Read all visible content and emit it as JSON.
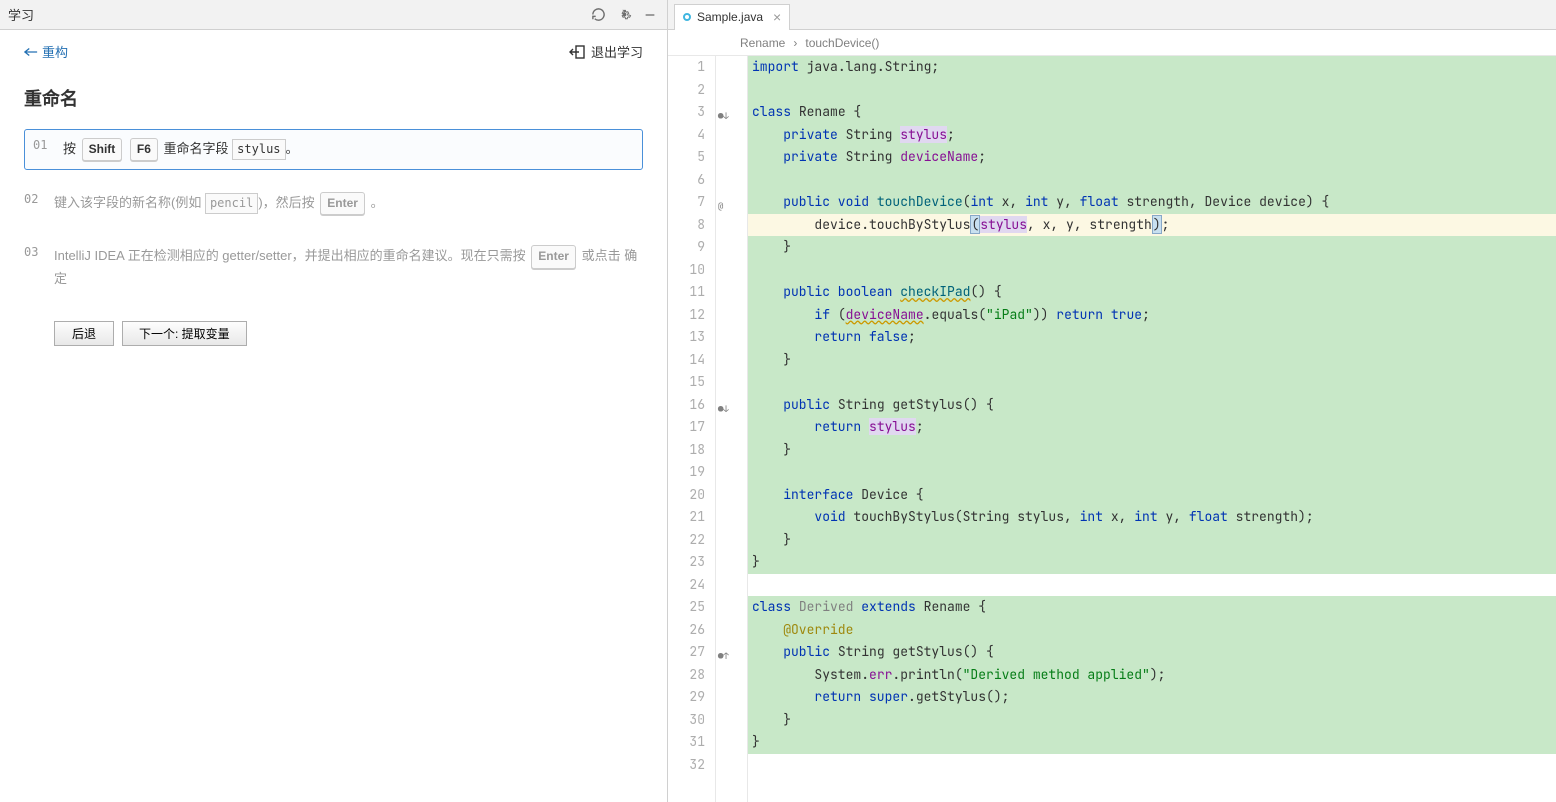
{
  "left": {
    "header_title": "学习",
    "back_label": "重构",
    "exit_label": "退出学习",
    "title": "重命名",
    "steps": [
      {
        "num": "01",
        "pre": "按 ",
        "k1": "Shift",
        "k2": "F6",
        "mid": " 重命名字段 ",
        "code": "stylus",
        "post": "。"
      },
      {
        "num": "02",
        "pre": "键入该字段的新名称(例如 ",
        "code": "pencil",
        "mid": ")，然后按 ",
        "k1": "Enter",
        "post": " 。"
      },
      {
        "num": "03",
        "text_a": "IntelliJ IDEA 正在检测相应的 getter/setter，并提出相应的重命名建议。现在只需按 ",
        "k1": "Enter",
        "text_b": " 或点击 确定"
      }
    ],
    "btn_back": "后退",
    "btn_next": "下一个: 提取变量"
  },
  "tab": {
    "filename": "Sample.java"
  },
  "breadcrumb": {
    "a": "Rename",
    "b": "touchDevice()"
  },
  "code": {
    "lines": [
      {
        "n": 1,
        "hl": "g",
        "tokens": [
          [
            "kw",
            "import"
          ],
          [
            "",
            " java.lang.String;"
          ]
        ]
      },
      {
        "n": 2,
        "hl": "g",
        "tokens": [
          [
            "",
            ""
          ]
        ]
      },
      {
        "n": 3,
        "hl": "g",
        "mark": "●↓",
        "tokens": [
          [
            "kw",
            "class"
          ],
          [
            "",
            " Rename {"
          ]
        ]
      },
      {
        "n": 4,
        "hl": "g",
        "tokens": [
          [
            "",
            "    "
          ],
          [
            "kw",
            "private"
          ],
          [
            "",
            " String "
          ],
          [
            "field hl-mark",
            "stylus"
          ],
          [
            "",
            ";"
          ]
        ]
      },
      {
        "n": 5,
        "hl": "g",
        "tokens": [
          [
            "",
            "    "
          ],
          [
            "kw",
            "private"
          ],
          [
            "",
            " String "
          ],
          [
            "field",
            "deviceName"
          ],
          [
            "",
            ";"
          ]
        ]
      },
      {
        "n": 6,
        "hl": "g",
        "tokens": [
          [
            "",
            ""
          ]
        ]
      },
      {
        "n": 7,
        "hl": "g",
        "mark": "@",
        "tokens": [
          [
            "",
            "    "
          ],
          [
            "kw",
            "public void"
          ],
          [
            "",
            " "
          ],
          [
            "method-decl",
            "touchDevice"
          ],
          [
            "",
            "("
          ],
          [
            "kw",
            "int"
          ],
          [
            "",
            " x, "
          ],
          [
            "kw",
            "int"
          ],
          [
            "",
            " y, "
          ],
          [
            "kw",
            "float"
          ],
          [
            "",
            " strength, Device device) {"
          ]
        ]
      },
      {
        "n": 8,
        "hl": "y",
        "tokens": [
          [
            "",
            "        device.touchByStylus"
          ],
          [
            "hl-paren",
            "("
          ],
          [
            "field hl-mark",
            "stylus"
          ],
          [
            "",
            ", x, y, strength"
          ],
          [
            "hl-paren",
            ")"
          ],
          [
            "",
            ";"
          ]
        ]
      },
      {
        "n": 9,
        "hl": "g",
        "tokens": [
          [
            "",
            "    }"
          ]
        ]
      },
      {
        "n": 10,
        "hl": "g",
        "tokens": [
          [
            "",
            ""
          ]
        ]
      },
      {
        "n": 11,
        "hl": "g",
        "tokens": [
          [
            "",
            "    "
          ],
          [
            "kw",
            "public boolean"
          ],
          [
            "",
            " "
          ],
          [
            "method-decl warn",
            "checkIPad"
          ],
          [
            "",
            "() {"
          ]
        ]
      },
      {
        "n": 12,
        "hl": "g",
        "tokens": [
          [
            "",
            "        "
          ],
          [
            "kw",
            "if"
          ],
          [
            "",
            " ("
          ],
          [
            "field warn",
            "deviceName"
          ],
          [
            "",
            ".equals("
          ],
          [
            "str",
            "\"iPad\""
          ],
          [
            "",
            ")) "
          ],
          [
            "kw",
            "return true"
          ],
          [
            "",
            ";"
          ]
        ]
      },
      {
        "n": 13,
        "hl": "g",
        "tokens": [
          [
            "",
            "        "
          ],
          [
            "kw",
            "return false"
          ],
          [
            "",
            ";"
          ]
        ]
      },
      {
        "n": 14,
        "hl": "g",
        "tokens": [
          [
            "",
            "    }"
          ]
        ]
      },
      {
        "n": 15,
        "hl": "g",
        "tokens": [
          [
            "",
            ""
          ]
        ]
      },
      {
        "n": 16,
        "hl": "g",
        "mark": "●↓",
        "tokens": [
          [
            "",
            "    "
          ],
          [
            "kw",
            "public"
          ],
          [
            "",
            " String getStylus() {"
          ]
        ]
      },
      {
        "n": 17,
        "hl": "g",
        "tokens": [
          [
            "",
            "        "
          ],
          [
            "kw",
            "return"
          ],
          [
            "",
            " "
          ],
          [
            "field hl-mark",
            "stylus"
          ],
          [
            "",
            ";"
          ]
        ]
      },
      {
        "n": 18,
        "hl": "g",
        "tokens": [
          [
            "",
            "    }"
          ]
        ]
      },
      {
        "n": 19,
        "hl": "g",
        "tokens": [
          [
            "",
            ""
          ]
        ]
      },
      {
        "n": 20,
        "hl": "g",
        "tokens": [
          [
            "",
            "    "
          ],
          [
            "kw",
            "interface"
          ],
          [
            "",
            " Device {"
          ]
        ]
      },
      {
        "n": 21,
        "hl": "g",
        "tokens": [
          [
            "",
            "        "
          ],
          [
            "kw",
            "void"
          ],
          [
            "",
            " touchByStylus(String stylus, "
          ],
          [
            "kw",
            "int"
          ],
          [
            "",
            " x, "
          ],
          [
            "kw",
            "int"
          ],
          [
            "",
            " y, "
          ],
          [
            "kw",
            "float"
          ],
          [
            "",
            " strength);"
          ]
        ]
      },
      {
        "n": 22,
        "hl": "g",
        "tokens": [
          [
            "",
            "    }"
          ]
        ]
      },
      {
        "n": 23,
        "hl": "g",
        "tokens": [
          [
            "",
            "}"
          ]
        ]
      },
      {
        "n": 24,
        "hl": "",
        "tokens": [
          [
            "",
            ""
          ]
        ]
      },
      {
        "n": 25,
        "hl": "g",
        "tokens": [
          [
            "kw",
            "class"
          ],
          [
            "",
            " "
          ],
          [
            "unused",
            "Derived"
          ],
          [
            "",
            " "
          ],
          [
            "kw",
            "extends"
          ],
          [
            "",
            " Rename {"
          ]
        ]
      },
      {
        "n": 26,
        "hl": "g",
        "tokens": [
          [
            "",
            "    "
          ],
          [
            "anno",
            "@Override"
          ]
        ]
      },
      {
        "n": 27,
        "hl": "g",
        "mark": "●↑",
        "tokens": [
          [
            "",
            "    "
          ],
          [
            "kw",
            "public"
          ],
          [
            "",
            " String getStylus() {"
          ]
        ]
      },
      {
        "n": 28,
        "hl": "g",
        "tokens": [
          [
            "",
            "        System."
          ],
          [
            "field",
            "err"
          ],
          [
            "",
            ".println("
          ],
          [
            "str",
            "\"Derived method applied\""
          ],
          [
            "",
            ");"
          ]
        ]
      },
      {
        "n": 29,
        "hl": "g",
        "tokens": [
          [
            "",
            "        "
          ],
          [
            "kw",
            "return super"
          ],
          [
            "",
            ".getStylus();"
          ]
        ]
      },
      {
        "n": 30,
        "hl": "g",
        "tokens": [
          [
            "",
            "    }"
          ]
        ]
      },
      {
        "n": 31,
        "hl": "g",
        "tokens": [
          [
            "",
            "}"
          ]
        ]
      },
      {
        "n": 32,
        "hl": "",
        "tokens": [
          [
            "",
            ""
          ]
        ]
      }
    ]
  }
}
